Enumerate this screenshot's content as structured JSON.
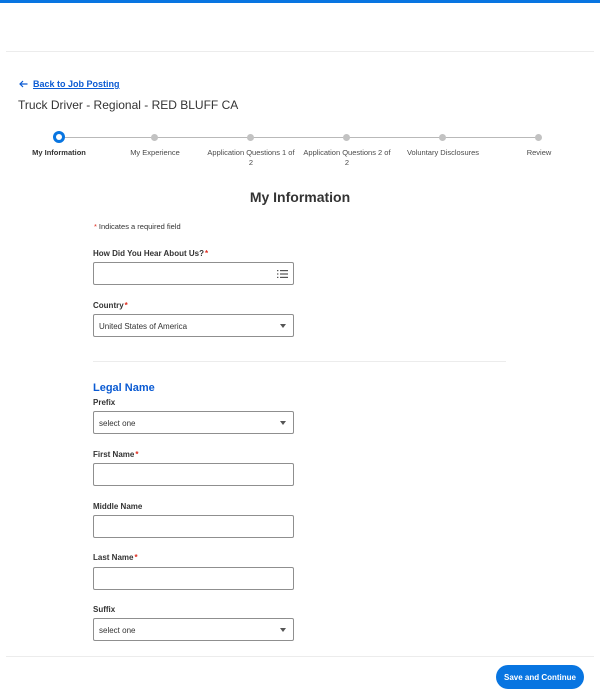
{
  "header": {
    "back_link": "Back to Job Posting",
    "job_title": "Truck Driver - Regional - RED BLUFF CA"
  },
  "stepper": {
    "steps": [
      {
        "label": "My Information",
        "active": true
      },
      {
        "label": "My Experience",
        "active": false
      },
      {
        "label": "Application Questions 1 of 2",
        "active": false
      },
      {
        "label": "Application Questions 2 of 2",
        "active": false
      },
      {
        "label": "Voluntary Disclosures",
        "active": false
      },
      {
        "label": "Review",
        "active": false
      }
    ]
  },
  "form": {
    "heading": "My Information",
    "required_note": "Indicates a required field",
    "required_mark": "*",
    "how_heard": {
      "label": "How Did You Hear About Us?",
      "value": ""
    },
    "country": {
      "label": "Country",
      "value": "United States of America"
    },
    "legal_name": {
      "heading": "Legal Name",
      "prefix": {
        "label": "Prefix",
        "value": "select one"
      },
      "first_name": {
        "label": "First Name",
        "value": ""
      },
      "middle_name": {
        "label": "Middle Name",
        "value": ""
      },
      "last_name": {
        "label": "Last Name",
        "value": ""
      },
      "suffix": {
        "label": "Suffix",
        "value": "select one"
      }
    }
  },
  "footer": {
    "save_button": "Save and Continue"
  },
  "colors": {
    "accent": "#0875e1",
    "link": "#0b5bd3",
    "required": "#de2e21"
  },
  "icons": {
    "back": "arrow-left-icon",
    "multiselect": "list-icon",
    "dropdown": "chevron-down-icon"
  }
}
